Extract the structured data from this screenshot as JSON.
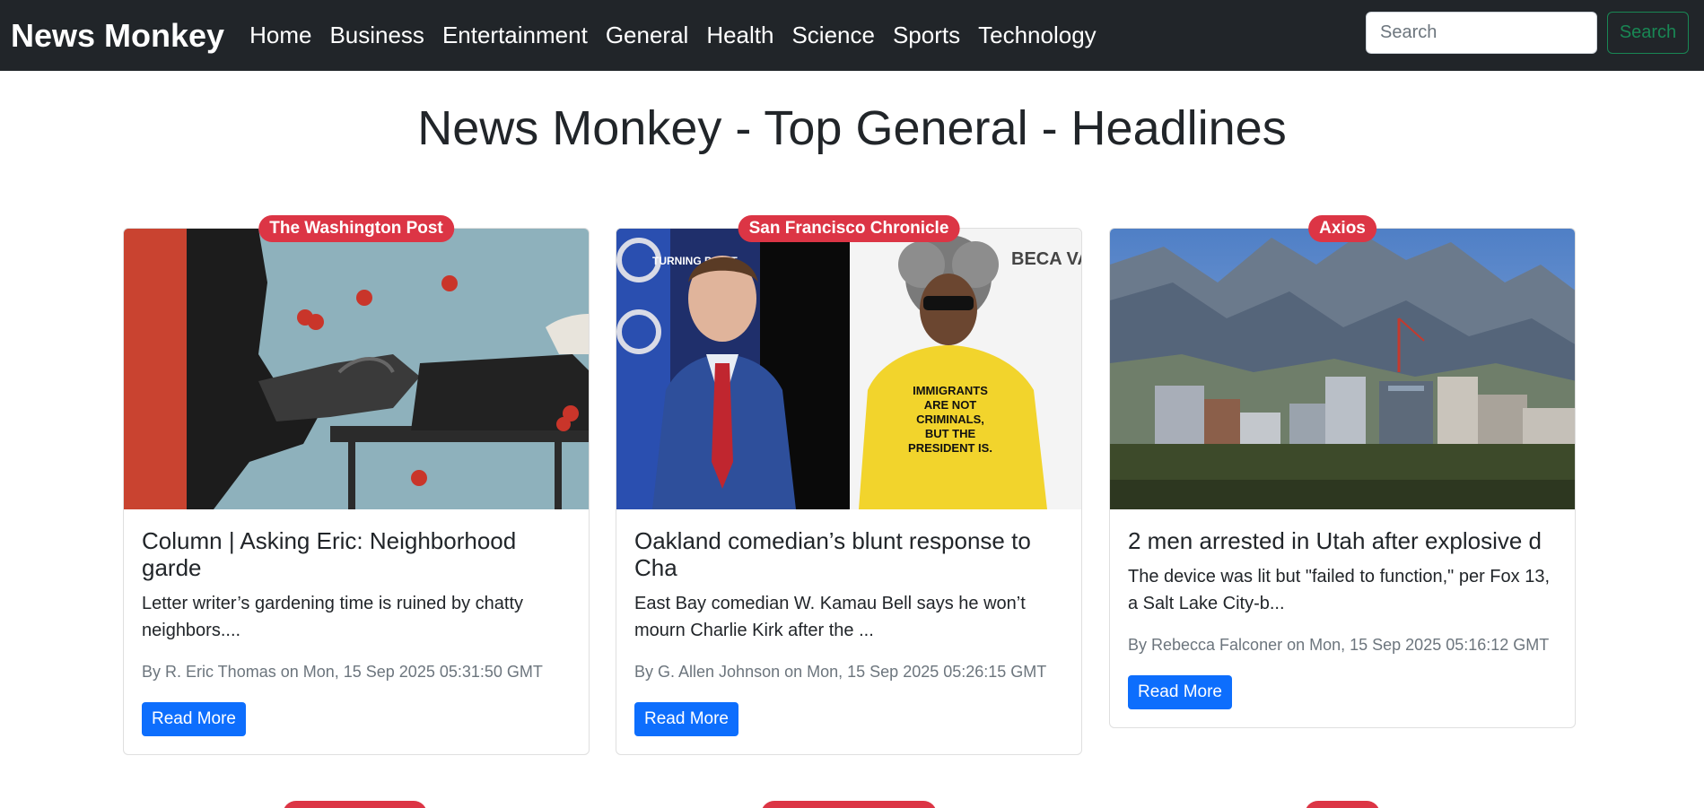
{
  "nav": {
    "brand": "News Monkey",
    "links": [
      "Home",
      "Business",
      "Entertainment",
      "General",
      "Health",
      "Science",
      "Sports",
      "Technology"
    ],
    "search_placeholder": "Search",
    "search_button": "Search"
  },
  "page_title": "News Monkey - Top General - Headlines",
  "articles": [
    {
      "source": "The Washington Post",
      "title": "Column | Asking Eric: Neighborhood garde",
      "description": "Letter writer’s gardening time is ruined by chatty neighbors....",
      "meta": "By R. Eric Thomas on Mon, 15 Sep 2025 05:31:50 GMT",
      "button": "Read More"
    },
    {
      "source": "San Francisco Chronicle",
      "title": "Oakland comedian’s blunt response to Cha",
      "description": "East Bay comedian W. Kamau Bell says he won’t mourn Charlie Kirk after the ...",
      "meta": "By G. Allen Johnson on Mon, 15 Sep 2025 05:26:15 GMT",
      "button": "Read More"
    },
    {
      "source": "Axios",
      "title": "2 men arrested in Utah after explosive d",
      "description": "The device was lit but \"failed to function,\" per Fox 13, a Salt Lake City-b...",
      "meta": "By Rebecca Falconer on Mon, 15 Sep 2025 05:16:12 GMT",
      "button": "Read More"
    }
  ],
  "image_text": {
    "img2_left_sign": "TURNING POINT",
    "img2_shirt": "IMMIGRANTS ARE NOT CRIMINALS, BUT THE PRESIDENT IS.",
    "img2_backdrop": "BECA VAL"
  },
  "colors": {
    "navbar": "#212529",
    "badge": "#dc3545",
    "primary_button": "#0d6efd",
    "search_button": "#198754"
  }
}
